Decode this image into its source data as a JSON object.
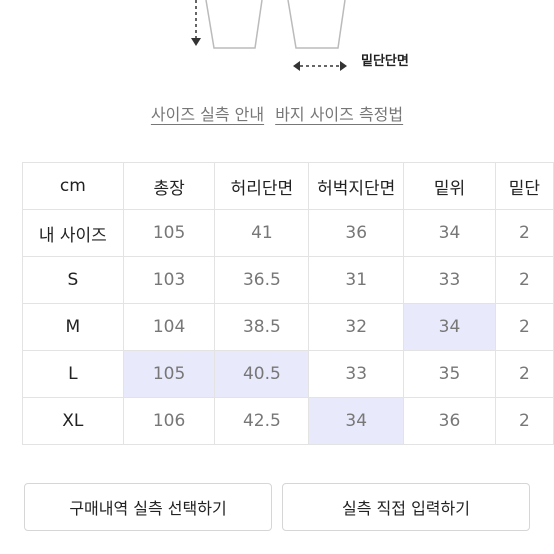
{
  "diagram": {
    "hem_label": "밑단단면"
  },
  "links": {
    "size_guide": "사이즈 실측 안내",
    "pants_measure": "바지 사이즈 측정법"
  },
  "table": {
    "headers": [
      "cm",
      "총장",
      "허리단면",
      "허벅지단면",
      "밑위",
      "밑단"
    ],
    "rows": [
      {
        "label": "내 사이즈",
        "values": [
          "105",
          "41",
          "36",
          "34",
          "2"
        ]
      },
      {
        "label": "S",
        "values": [
          "103",
          "36.5",
          "31",
          "33",
          "2"
        ]
      },
      {
        "label": "M",
        "values": [
          "104",
          "38.5",
          "32",
          "34",
          "2"
        ]
      },
      {
        "label": "L",
        "values": [
          "105",
          "40.5",
          "33",
          "35",
          "2"
        ]
      },
      {
        "label": "XL",
        "values": [
          "106",
          "42.5",
          "34",
          "36",
          "2"
        ]
      }
    ],
    "highlight_color": "#e8e9fb"
  },
  "buttons": {
    "history": "구매내역 실측 선택하기",
    "direct": "실측 직접 입력하기"
  }
}
